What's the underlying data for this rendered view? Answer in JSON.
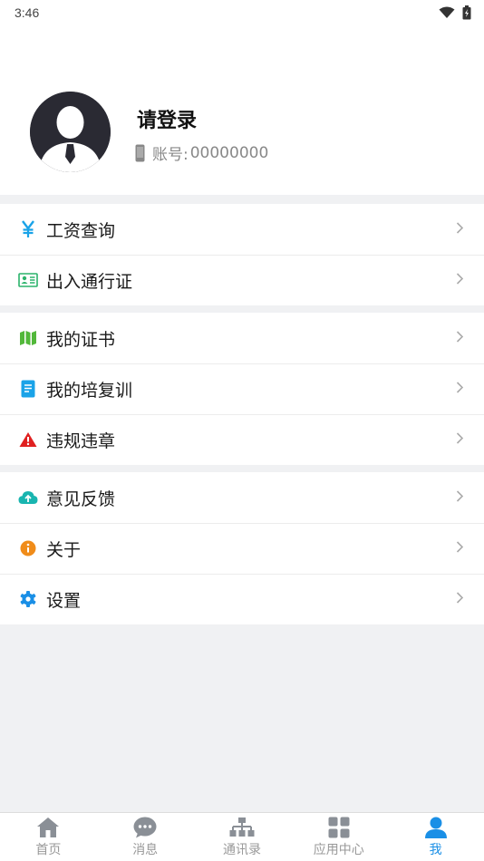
{
  "status": {
    "time": "3:46"
  },
  "profile": {
    "name": "请登录",
    "account_label": "账号:",
    "account_value": "00000000"
  },
  "groups": [
    [
      {
        "label": "工资查询",
        "icon": "yen-icon",
        "color": "#1aa3e8"
      },
      {
        "label": "出入通行证",
        "icon": "id-card-icon",
        "color": "#2bb36b"
      }
    ],
    [
      {
        "label": "我的证书",
        "icon": "map-icon",
        "color": "#52b83a"
      },
      {
        "label": "我的培复训",
        "icon": "document-icon",
        "color": "#1aa3e8"
      },
      {
        "label": "违规违章",
        "icon": "warning-icon",
        "color": "#e02020"
      }
    ],
    [
      {
        "label": "意见反馈",
        "icon": "cloud-upload-icon",
        "color": "#19b5b0"
      },
      {
        "label": "关于",
        "icon": "info-icon",
        "color": "#f08c1a"
      },
      {
        "label": "设置",
        "icon": "gear-icon",
        "color": "#1a8fe6"
      }
    ]
  ],
  "tabs": [
    {
      "label": "首页",
      "icon": "home-icon"
    },
    {
      "label": "消息",
      "icon": "chat-icon"
    },
    {
      "label": "通讯录",
      "icon": "org-chart-icon"
    },
    {
      "label": "应用中心",
      "icon": "grid-icon"
    },
    {
      "label": "我",
      "icon": "person-icon",
      "active": true
    }
  ],
  "colors": {
    "accent": "#1a8fe6",
    "inactive": "#8a8f96"
  }
}
